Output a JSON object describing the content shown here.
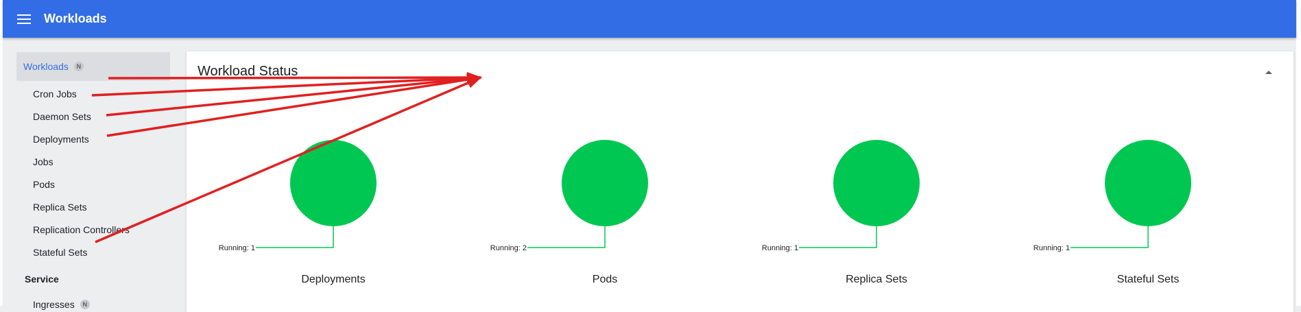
{
  "header": {
    "title": "Workloads",
    "menu_icon": "hamburger-menu-icon",
    "bar_color": "#326de6"
  },
  "sidebar": {
    "workloads": {
      "label": "Workloads",
      "badge": "N"
    },
    "items": [
      {
        "label": "Cron Jobs"
      },
      {
        "label": "Daemon Sets"
      },
      {
        "label": "Deployments"
      },
      {
        "label": "Jobs"
      },
      {
        "label": "Pods"
      },
      {
        "label": "Replica Sets"
      },
      {
        "label": "Replication Controllers"
      },
      {
        "label": "Stateful Sets"
      }
    ],
    "service_section": {
      "label": "Service"
    },
    "ingresses": {
      "label": "Ingresses",
      "badge": "N"
    }
  },
  "workload_status": {
    "title": "Workload Status",
    "collapse_icon": "caret-up-icon",
    "running_color": "#00c752",
    "charts": [
      {
        "label": "Deployments",
        "status": "Running",
        "count": 1,
        "legend": "Running: 1"
      },
      {
        "label": "Pods",
        "status": "Running",
        "count": 2,
        "legend": "Running: 2"
      },
      {
        "label": "Replica Sets",
        "status": "Running",
        "count": 1,
        "legend": "Running: 1"
      },
      {
        "label": "Stateful Sets",
        "status": "Running",
        "count": 1,
        "legend": "Running: 1"
      }
    ]
  },
  "annotation": {
    "color": "#e02020",
    "type": "red-arrows-pointing-to-sidebar-items"
  }
}
